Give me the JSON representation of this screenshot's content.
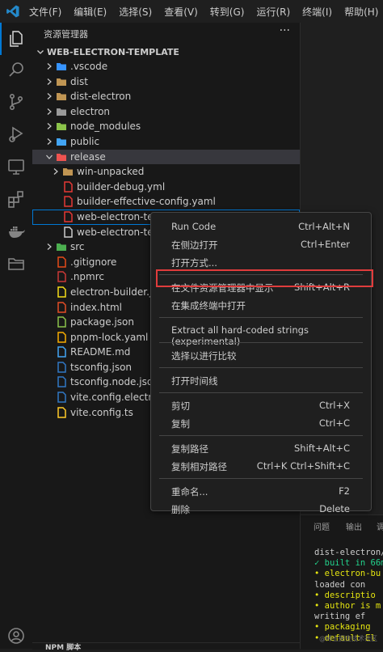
{
  "menubar": [
    "文件(F)",
    "编辑(E)",
    "选择(S)",
    "查看(V)",
    "转到(G)",
    "运行(R)",
    "终端(I)",
    "帮助(H)"
  ],
  "sidebar": {
    "title": "资源管理器",
    "more": "···",
    "section": "WEB-ELECTRON-TEMPLATE"
  },
  "tree": [
    {
      "name": ".vscode",
      "type": "folder",
      "color": "#3794ff",
      "level": 1
    },
    {
      "name": "dist",
      "type": "folder",
      "color": "#c09553",
      "level": 1
    },
    {
      "name": "dist-electron",
      "type": "folder",
      "color": "#c09553",
      "level": 1
    },
    {
      "name": "electron",
      "type": "folder",
      "color": "#9a9a9a",
      "level": 1
    },
    {
      "name": "node_modules",
      "type": "folder",
      "color": "#8bc34a",
      "level": 1
    },
    {
      "name": "public",
      "type": "folder",
      "color": "#42a5f5",
      "level": 1
    },
    {
      "name": "release",
      "type": "folder-open",
      "color": "#ef5350",
      "level": 1
    },
    {
      "name": "win-unpacked",
      "type": "folder",
      "color": "#c09553",
      "level": 2
    },
    {
      "name": "builder-debug.yml",
      "type": "file",
      "color": "#e53935",
      "level": 2
    },
    {
      "name": "builder-effective-config.yaml",
      "type": "file",
      "color": "#e53935",
      "level": 2
    },
    {
      "name": "web-electron-templ",
      "type": "file",
      "color": "#e53935",
      "level": 2
    },
    {
      "name": "web-electron-temp",
      "type": "file",
      "color": "#cccccc",
      "level": 2
    },
    {
      "name": "src",
      "type": "folder",
      "color": "#4caf50",
      "level": 1
    },
    {
      "name": ".gitignore",
      "type": "file",
      "color": "#e64a19",
      "level": 1
    },
    {
      "name": ".npmrc",
      "type": "file",
      "color": "#cb3837",
      "level": 1
    },
    {
      "name": "electron-builder.json",
      "type": "file",
      "color": "#f5de19",
      "level": 1
    },
    {
      "name": "index.html",
      "type": "file",
      "color": "#e44d26",
      "level": 1
    },
    {
      "name": "package.json",
      "type": "file",
      "color": "#8bc34a",
      "level": 1
    },
    {
      "name": "pnpm-lock.yaml",
      "type": "file",
      "color": "#f9ad00",
      "level": 1
    },
    {
      "name": "README.md",
      "type": "file",
      "color": "#42a5f5",
      "level": 1
    },
    {
      "name": "tsconfig.json",
      "type": "file",
      "color": "#3178c6",
      "level": 1
    },
    {
      "name": "tsconfig.node.json",
      "type": "file",
      "color": "#3178c6",
      "level": 1
    },
    {
      "name": "vite.config.electron.ts",
      "type": "file",
      "color": "#3178c6",
      "level": 1
    },
    {
      "name": "vite.config.ts",
      "type": "file",
      "color": "#ffca28",
      "level": 1
    }
  ],
  "contextMenu": [
    {
      "label": "Run Code",
      "key": "Ctrl+Alt+N"
    },
    {
      "label": "在侧边打开",
      "key": "Ctrl+Enter"
    },
    {
      "label": "打开方式...",
      "key": ""
    },
    {
      "sep": true
    },
    {
      "label": "在文件资源管理器中显示",
      "key": "Shift+Alt+R"
    },
    {
      "label": "在集成终端中打开",
      "key": ""
    },
    {
      "sep": true
    },
    {
      "label": "Extract all hard-coded strings (experimental)",
      "key": ""
    },
    {
      "sep": true
    },
    {
      "label": "选择以进行比较",
      "key": ""
    },
    {
      "sep": true
    },
    {
      "label": "打开时间线",
      "key": ""
    },
    {
      "sep": true
    },
    {
      "label": "剪切",
      "key": "Ctrl+X"
    },
    {
      "label": "复制",
      "key": "Ctrl+C"
    },
    {
      "sep": true
    },
    {
      "label": "复制路径",
      "key": "Shift+Alt+C"
    },
    {
      "label": "复制相对路径",
      "key": "Ctrl+K Ctrl+Shift+C"
    },
    {
      "sep": true
    },
    {
      "label": "重命名...",
      "key": "F2"
    },
    {
      "label": "删除",
      "key": "Delete"
    }
  ],
  "panel": {
    "tabs": [
      "问题",
      "输出",
      "调"
    ]
  },
  "terminal": [
    {
      "text": "dist-electron/m",
      "cls": ""
    },
    {
      "text": "✓ built in 66m",
      "cls": "g"
    },
    {
      "text": "• electron-bu",
      "cls": "dot"
    },
    {
      "text": "  loaded con",
      "cls": ""
    },
    {
      "text": "• descriptio",
      "cls": "dot"
    },
    {
      "text": "• author is m",
      "cls": "dot"
    },
    {
      "text": "  writing ef",
      "cls": ""
    },
    {
      "text": "• packaging",
      "cls": "dot"
    },
    {
      "text": "• default El",
      "cls": "dot"
    }
  ],
  "bottom": {
    "label": "NPM 脚本"
  },
  "watermark": "@稀土掘金技术社区",
  "colors": {
    "accent": "#0078d4",
    "highlight": "#e03c3c"
  }
}
